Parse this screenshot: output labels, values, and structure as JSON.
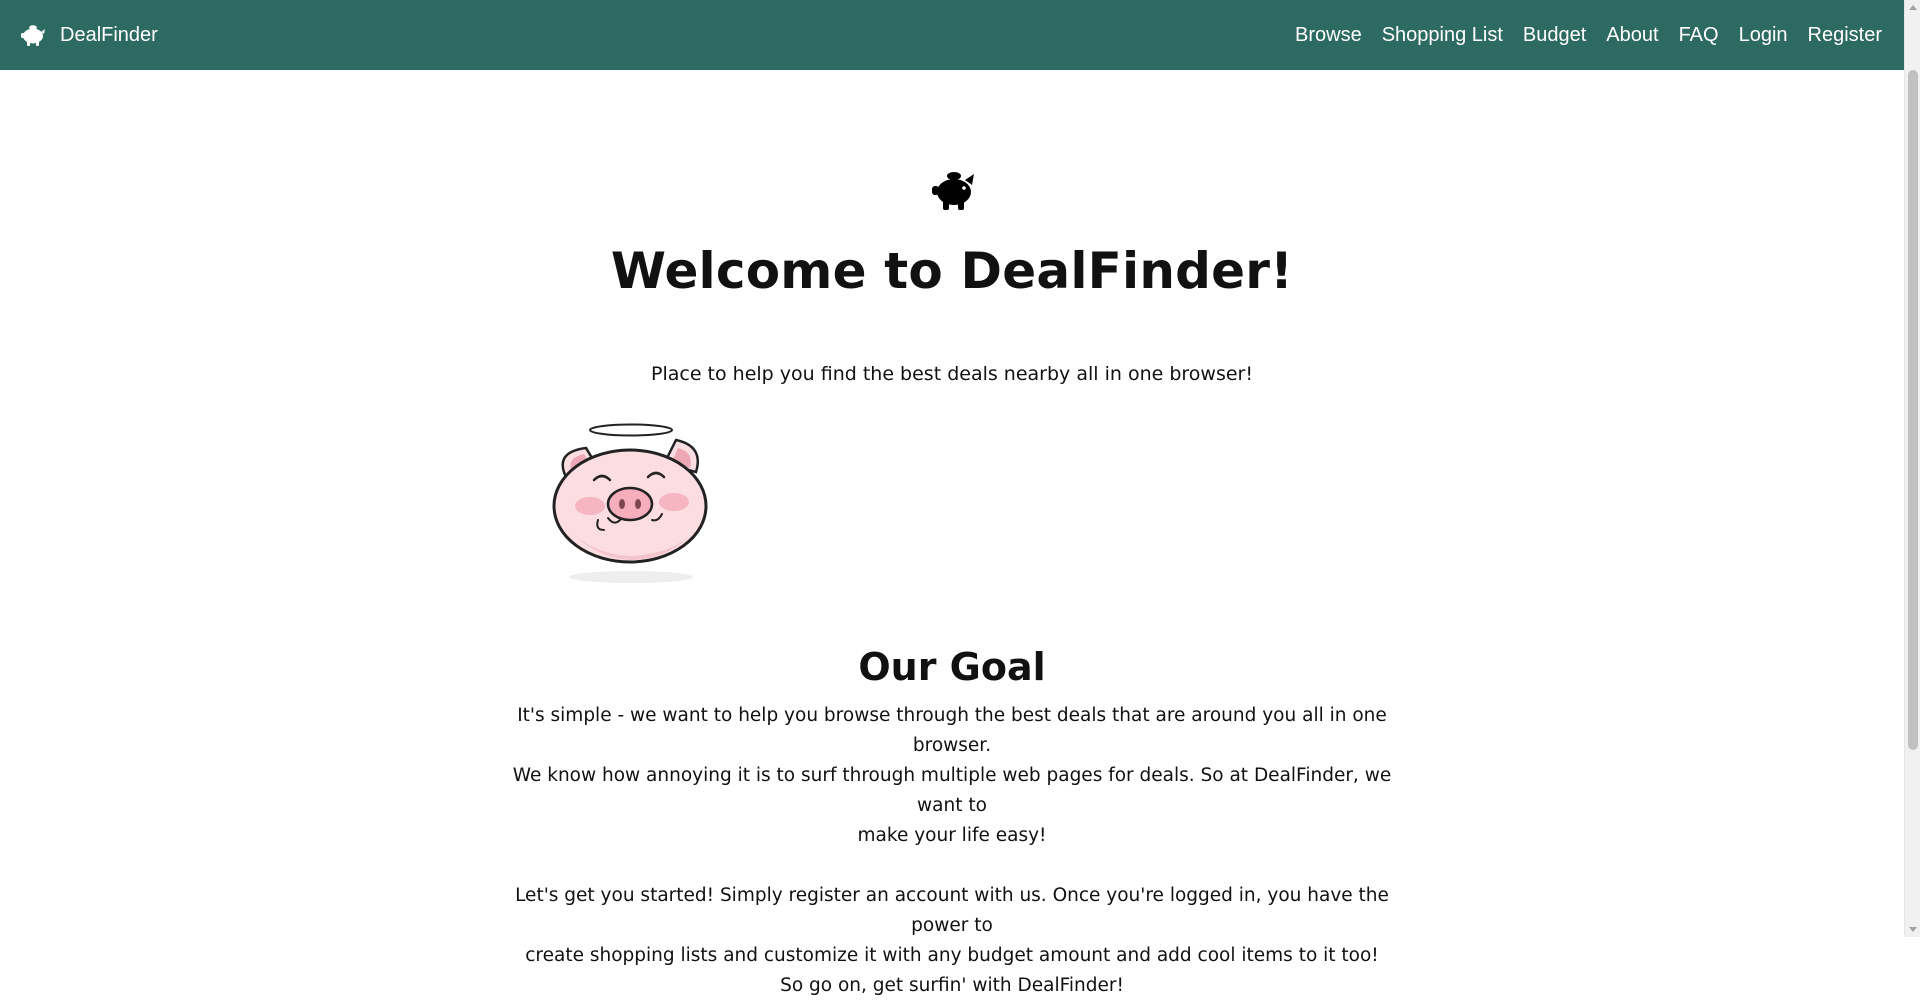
{
  "navbar": {
    "brand": "DealFinder",
    "links": [
      "Browse",
      "Shopping List",
      "Budget",
      "About",
      "FAQ",
      "Login",
      "Register"
    ],
    "background_color": "#2d6a61",
    "brand_icon": "piggy-bank-icon"
  },
  "hero": {
    "icon": "piggy-bank-icon",
    "title": "Welcome to DealFinder!",
    "tagline": "Place to help you find the best deals nearby all in one browser!",
    "image": "angel-pig-illustration"
  },
  "goal": {
    "heading": "Our Goal",
    "paragraph1_lines": [
      "It's simple - we want to help you browse through the best deals that are around you all in one browser.",
      "We know how annoying it is to surf through multiple web pages for deals. So at DealFinder, we want to",
      "make your life easy!"
    ],
    "paragraph2_lines": [
      "Let's get you started! Simply register an account with us. Once you're logged in, you have the power to",
      "create shopping lists and customize it with any budget amount and add cool items to it too!",
      "So go on, get surfin' with DealFinder!"
    ]
  }
}
